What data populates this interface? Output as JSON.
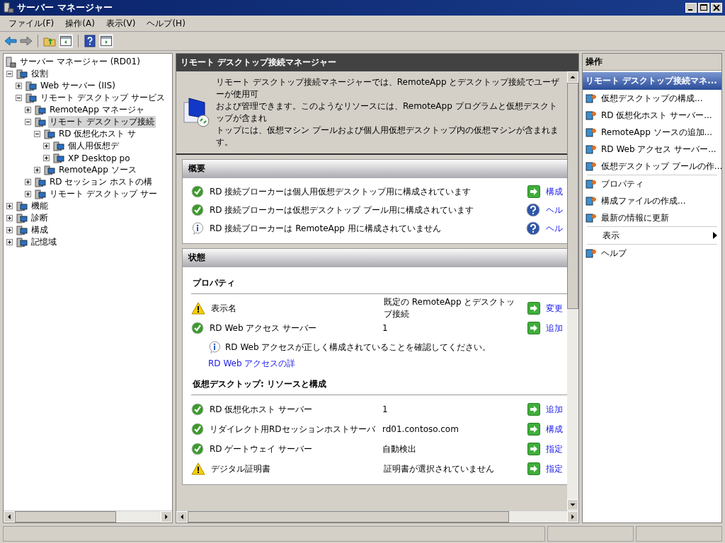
{
  "window": {
    "title": "サーバー マネージャー"
  },
  "menu": [
    "ファイル(F)",
    "操作(A)",
    "表示(V)",
    "ヘルプ(H)"
  ],
  "tree": {
    "root": "サーバー マネージャー (RD01)",
    "children": [
      {
        "label": "役割",
        "expanded": true,
        "selected": false,
        "children": [
          {
            "label": "Web サーバー (IIS)",
            "expanded": false,
            "selected": false
          },
          {
            "label": "リモート デスクトップ サービス",
            "expanded": true,
            "selected": false,
            "children": [
              {
                "label": "RemoteApp マネージャ",
                "expanded": false,
                "selected": false
              },
              {
                "label": "リモート デスクトップ接続",
                "expanded": true,
                "selected": true,
                "children": [
                  {
                    "label": "RD 仮想化ホスト サ",
                    "expanded": true,
                    "selected": false,
                    "children": [
                      {
                        "label": "個人用仮想デ",
                        "expanded": false,
                        "selected": false
                      },
                      {
                        "label": "XP Desktop po",
                        "expanded": false,
                        "selected": false
                      }
                    ]
                  },
                  {
                    "label": "RemoteApp ソース",
                    "expanded": false,
                    "selected": false
                  }
                ]
              },
              {
                "label": "RD セッション ホストの構",
                "expanded": false,
                "selected": false
              },
              {
                "label": "リモート デスクトップ サー",
                "expanded": false,
                "selected": false
              }
            ]
          }
        ]
      },
      {
        "label": "機能",
        "expanded": false,
        "selected": false
      },
      {
        "label": "診断",
        "expanded": false,
        "selected": false
      },
      {
        "label": "構成",
        "expanded": false,
        "selected": false
      },
      {
        "label": "記憶域",
        "expanded": false,
        "selected": false
      }
    ]
  },
  "center": {
    "title": "リモート デスクトップ接続マネージャー",
    "description": [
      "リモート デスクトップ接続マネージャーでは、RemoteApp とデスクトップ接続でユーザーが使用可",
      "および管理できます。このようなリソースには、RemoteApp プログラムと仮想デスクトップが含まれ",
      "トップには、仮想マシン プールおよび個人用仮想デスクトップ内の仮想マシンが含まれます。"
    ],
    "overview": {
      "title": "概要",
      "rows": [
        {
          "kind": "ok",
          "text": "RD 接続ブローカーは個人用仮想デスクトップ用に構成されています",
          "action": {
            "kind": "arrow",
            "link": "構成"
          }
        },
        {
          "kind": "ok",
          "text": "RD 接続ブローカーは仮想デスクトップ プール用に構成されています",
          "action": {
            "kind": "help",
            "link": "ヘル"
          }
        },
        {
          "kind": "info",
          "text": "RD 接続ブローカーは RemoteApp 用に構成されていません",
          "action": {
            "kind": "help",
            "link": "ヘル"
          }
        }
      ]
    },
    "status": {
      "title": "状態",
      "groups": [
        {
          "title": "プロパティ",
          "rows": [
            {
              "kind": "warn",
              "label": "表示名",
              "value": "既定の RemoteApp とデスクトップ接続",
              "link": "変更"
            },
            {
              "kind": "ok",
              "label": "RD Web アクセス サーバー",
              "value": "1",
              "link": "追加"
            },
            {
              "kind": "note",
              "text": "RD Web アクセスが正しく構成されていることを確認してください。",
              "link": "RD Web アクセスの詳"
            }
          ]
        },
        {
          "title": "仮想デスクトップ: リソースと構成",
          "rows": [
            {
              "kind": "ok",
              "label": "RD 仮想化ホスト サーバー",
              "value": "1",
              "link": "追加"
            },
            {
              "kind": "ok",
              "label": "リダイレクト用RDセッションホストサーバ",
              "value": "rd01.contoso.com",
              "link": "構成"
            },
            {
              "kind": "ok",
              "label": "RD ゲートウェイ サーバー",
              "value": "自動検出",
              "link": "指定"
            },
            {
              "kind": "warn",
              "label": "デジタル証明書",
              "value": "証明書が選択されていません",
              "link": "指定"
            }
          ]
        }
      ]
    }
  },
  "actions": {
    "title": "操作",
    "section": "リモート デスクトップ接続マネ...",
    "items": [
      {
        "kind": "item",
        "label": "仮想デスクトップの構成..."
      },
      {
        "kind": "item",
        "label": "RD 仮想化ホスト サーバー..."
      },
      {
        "kind": "item",
        "label": "RemoteApp ソースの追加..."
      },
      {
        "kind": "item",
        "label": "RD Web アクセス サーバー..."
      },
      {
        "kind": "item",
        "label": "仮想デスクトップ プールの作..."
      },
      {
        "kind": "separator"
      },
      {
        "kind": "item",
        "label": "プロパティ"
      },
      {
        "kind": "item",
        "label": "構成ファイルの作成..."
      },
      {
        "kind": "item",
        "label": "最新の情報に更新"
      },
      {
        "kind": "separator"
      },
      {
        "kind": "submenu",
        "label": "表示"
      },
      {
        "kind": "separator"
      },
      {
        "kind": "item",
        "label": "ヘルプ"
      }
    ]
  }
}
